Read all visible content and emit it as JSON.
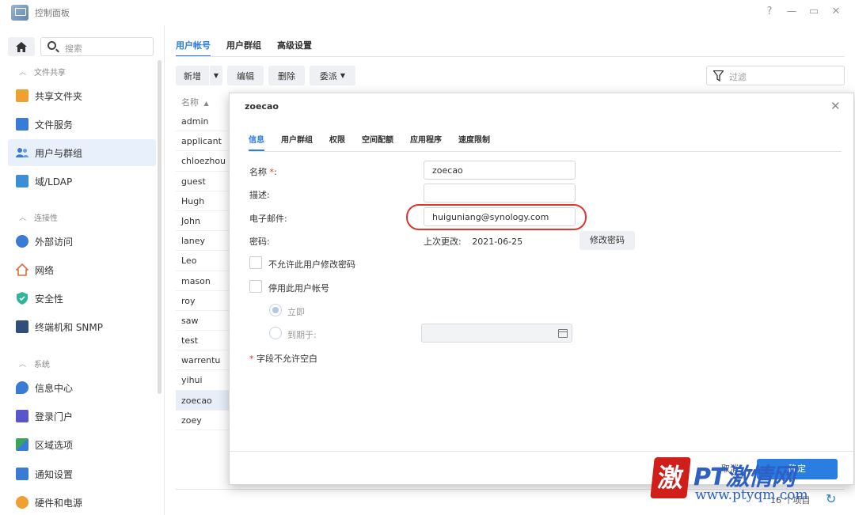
{
  "window": {
    "title": "控制面板",
    "controls": {
      "help": "?",
      "minimize": "—",
      "maximize": "▭",
      "close": "✕"
    }
  },
  "sidebar": {
    "search_placeholder": "搜索",
    "sections": [
      {
        "label": "文件共享",
        "items": [
          {
            "label": "共享文件夹",
            "icon": "shared-folder-icon",
            "color": "#f0a030"
          },
          {
            "label": "文件服务",
            "icon": "file-services-icon",
            "color": "#3a7bd5"
          },
          {
            "label": "用户与群组",
            "icon": "users-groups-icon",
            "color": "#3a7bd5",
            "active": true
          },
          {
            "label": "域/LDAP",
            "icon": "domain-ldap-icon",
            "color": "#3a8fd5"
          }
        ]
      },
      {
        "label": "连接性",
        "items": [
          {
            "label": "外部访问",
            "icon": "external-access-icon",
            "color": "#3a7bd5"
          },
          {
            "label": "网络",
            "icon": "network-icon",
            "color": "#e06a3a"
          },
          {
            "label": "安全性",
            "icon": "security-icon",
            "color": "#2fb59a"
          },
          {
            "label": "终端机和 SNMP",
            "icon": "terminal-snmp-icon",
            "color": "#2f4f7a"
          }
        ]
      },
      {
        "label": "系统",
        "items": [
          {
            "label": "信息中心",
            "icon": "info-center-icon",
            "color": "#3a7bd5"
          },
          {
            "label": "登录门户",
            "icon": "login-portal-icon",
            "color": "#5a55c8"
          },
          {
            "label": "区域选项",
            "icon": "regional-options-icon",
            "color": "#3aa55a"
          },
          {
            "label": "通知设置",
            "icon": "notification-icon",
            "color": "#3a7bd5"
          },
          {
            "label": "硬件和电源",
            "icon": "hardware-power-icon",
            "color": "#f0a030"
          }
        ]
      }
    ]
  },
  "main": {
    "tabs": [
      {
        "label": "用户帐号",
        "active": true
      },
      {
        "label": "用户群组"
      },
      {
        "label": "高级设置"
      }
    ],
    "toolbar": {
      "create": "新增",
      "edit": "编辑",
      "delete": "删除",
      "delegate": "委派"
    },
    "filter_placeholder": "过滤",
    "list_header": "名称",
    "users": [
      "admin",
      "applicant",
      "chloezhou",
      "guest",
      "Hugh",
      "John",
      "laney",
      "Leo",
      "mason",
      "roy",
      "saw",
      "test",
      "warrentu",
      "yihui",
      "zoecao",
      "zoey"
    ],
    "selected_user": "zoecao",
    "item_count": "16 个项目"
  },
  "modal": {
    "title": "zoecao",
    "tabs": [
      {
        "label": "信息",
        "active": true
      },
      {
        "label": "用户群组"
      },
      {
        "label": "权限"
      },
      {
        "label": "空间配额"
      },
      {
        "label": "应用程序"
      },
      {
        "label": "速度限制"
      }
    ],
    "fields": {
      "name_label": "名称",
      "required_mark": "*",
      "colon": ":",
      "name_value": "zoecao",
      "desc_label": "描述:",
      "desc_value": "",
      "email_label": "电子邮件:",
      "email_value": "huiguniang@synology.com",
      "password_label": "密码:",
      "last_change_label": "上次更改:",
      "last_change_value": "2021-06-25",
      "change_password_button": "修改密码",
      "disallow_change_label": "不允许此用户修改密码",
      "disable_account_label": "停用此用户帐号",
      "radio_now": "立即",
      "radio_until": "到期于:",
      "expiry_date": "",
      "required_note": "字段不允许空白"
    },
    "footer": {
      "cancel": "取消",
      "apply": "确定"
    }
  },
  "watermark": {
    "logo_char": "激",
    "title": "PT激情网",
    "url": "www.ptyqm.com"
  },
  "colors": {
    "accent": "#2a7de1",
    "highlight_ring": "#e0352b",
    "selected_row": "#e7eef8"
  }
}
